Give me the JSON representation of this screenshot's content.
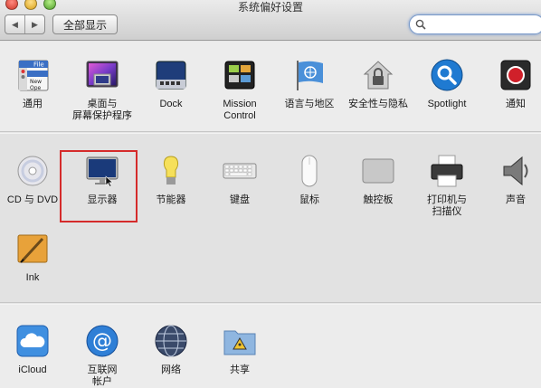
{
  "window": {
    "title": "系统偏好设置"
  },
  "toolbar": {
    "back": "◀",
    "forward": "▶",
    "show_all": "全部显示",
    "search_value": ""
  },
  "sections": [
    {
      "panes": [
        {
          "id": "general",
          "label": "通用",
          "label2": "",
          "icon": "file-window-icon"
        },
        {
          "id": "desktop",
          "label": "桌面与",
          "label2": "屏幕保护程序",
          "icon": "desktop-screensaver-icon"
        },
        {
          "id": "dock",
          "label": "Dock",
          "label2": "",
          "icon": "dock-icon"
        },
        {
          "id": "mission",
          "label": "Mission",
          "label2": "Control",
          "icon": "mission-control-icon"
        },
        {
          "id": "language",
          "label": "语言与地区",
          "label2": "",
          "icon": "un-flag-icon"
        },
        {
          "id": "security",
          "label": "安全性与隐私",
          "label2": "",
          "icon": "house-lock-icon"
        },
        {
          "id": "spotlight",
          "label": "Spotlight",
          "label2": "",
          "icon": "spotlight-icon"
        },
        {
          "id": "notifications",
          "label": "通知",
          "label2": "",
          "icon": "notifications-icon"
        }
      ]
    },
    {
      "panes": [
        {
          "id": "cddvd",
          "label": "CD 与 DVD",
          "label2": "",
          "icon": "disc-icon"
        },
        {
          "id": "displays",
          "label": "显示器",
          "label2": "",
          "icon": "display-icon"
        },
        {
          "id": "energy",
          "label": "节能器",
          "label2": "",
          "icon": "bulb-icon"
        },
        {
          "id": "keyboard",
          "label": "键盘",
          "label2": "",
          "icon": "keyboard-icon"
        },
        {
          "id": "mouse",
          "label": "鼠标",
          "label2": "",
          "icon": "mouse-icon"
        },
        {
          "id": "trackpad",
          "label": "触控板",
          "label2": "",
          "icon": "trackpad-icon"
        },
        {
          "id": "printers",
          "label": "打印机与",
          "label2": "扫描仪",
          "icon": "printer-icon"
        },
        {
          "id": "sound",
          "label": "声音",
          "label2": "",
          "icon": "speaker-icon"
        },
        {
          "id": "ink",
          "label": "Ink",
          "label2": "",
          "icon": "ink-pen-icon"
        }
      ]
    },
    {
      "panes": [
        {
          "id": "icloud",
          "label": "iCloud",
          "label2": "",
          "icon": "cloud-icon"
        },
        {
          "id": "internet",
          "label": "互联网",
          "label2": "帐户",
          "icon": "at-icon"
        },
        {
          "id": "network",
          "label": "网络",
          "label2": "",
          "icon": "globe-icon"
        },
        {
          "id": "sharing",
          "label": "共享",
          "label2": "",
          "icon": "sharing-folder-icon"
        }
      ]
    }
  ],
  "general_icon_text": {
    "tab": "File",
    "line1": "New",
    "line2": "Ope"
  },
  "colors": {
    "highlight": "#d52b2b",
    "spotlight": "#1f7ad1",
    "notifications": "#d0202a"
  }
}
